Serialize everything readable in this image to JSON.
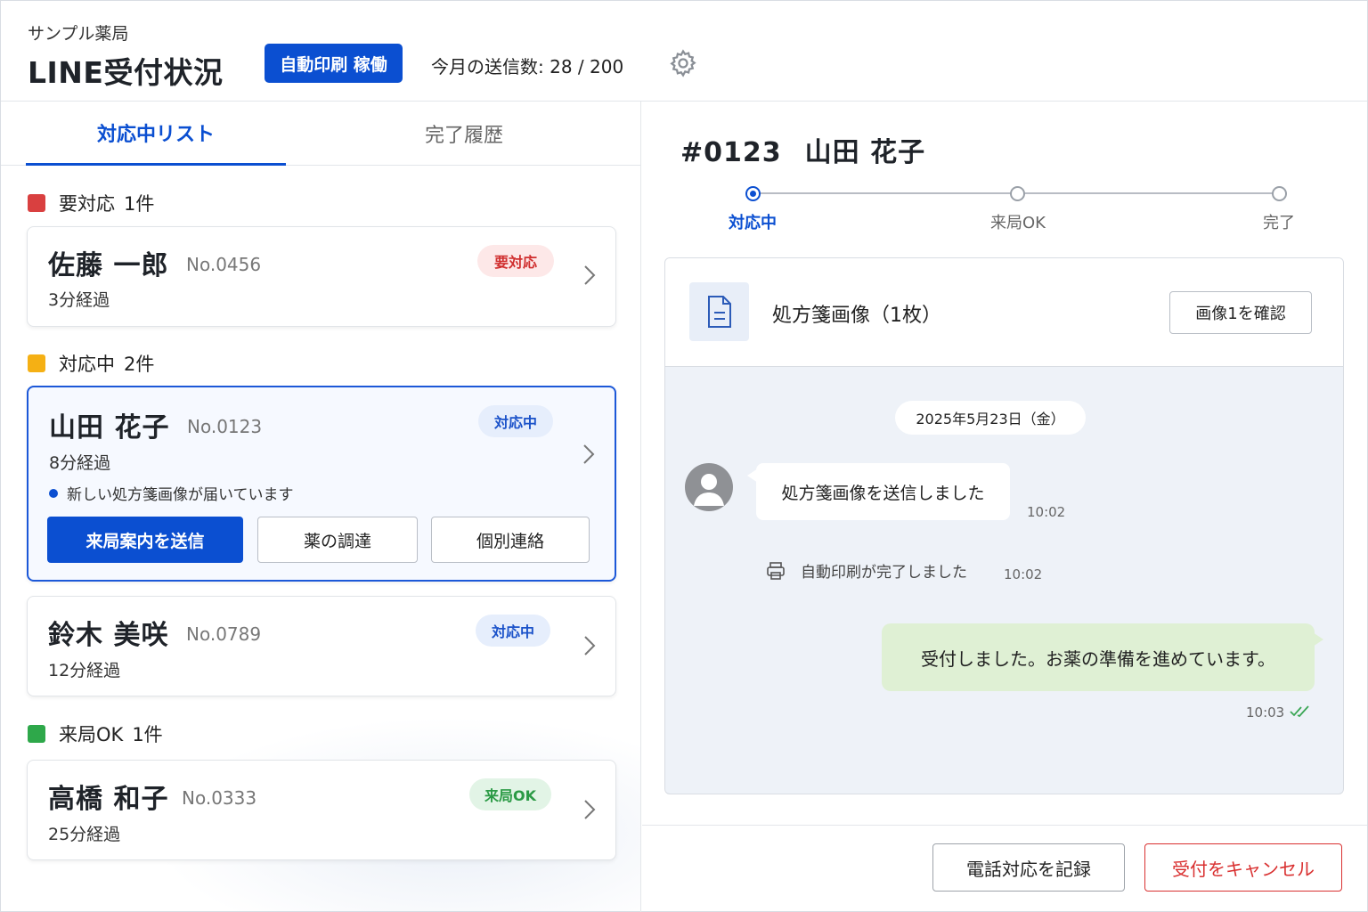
{
  "header": {
    "pharmacy_name": "サンプル薬局",
    "title": "LINE受付状況",
    "autoprint_badge": "自動印刷 稼働",
    "send_count": "今月の送信数: 28 / 200",
    "settings_icon": "gear-icon"
  },
  "tabs": [
    {
      "label": "対応中リスト",
      "active": true
    },
    {
      "label": "完了履歴",
      "active": false
    }
  ],
  "sections": {
    "needs_action": {
      "label": "要対応",
      "count": "1件",
      "color": "#d94040"
    },
    "in_progress": {
      "label": "対応中",
      "count": "2件",
      "color": "#f5b014"
    },
    "arrival_ok": {
      "label": "来局OK",
      "count": "1件",
      "color": "#2ea84a"
    }
  },
  "cards": [
    {
      "name": "佐藤 一郎",
      "no": "No.0456",
      "elapsed": "3分経過",
      "badge": "要対応"
    },
    {
      "name": "山田 花子",
      "no": "No.0123",
      "elapsed": "8分経過",
      "badge": "対応中",
      "notice": "新しい処方箋画像が届いています",
      "actions": [
        "来局案内を送信",
        "薬の調達",
        "個別連絡"
      ]
    },
    {
      "name": "鈴木 美咲",
      "no": "No.0789",
      "elapsed": "12分経過",
      "badge": "対応中"
    },
    {
      "name": "高橋 和子",
      "no": "No.0333",
      "elapsed": "25分経過",
      "badge": "来局OK"
    }
  ],
  "detail": {
    "number": "#0123",
    "name": "山田 花子",
    "steps": [
      {
        "label": "対応中",
        "active": true
      },
      {
        "label": "来局OK",
        "active": false
      },
      {
        "label": "完了",
        "active": false
      }
    ],
    "prescription_title": "処方箋画像（1枚）",
    "view_image_button": "画像1を確認",
    "date": "2025年5月23日（金）",
    "messages": {
      "incoming": {
        "text": "処方箋画像を送信しました",
        "time": "10:02"
      },
      "system": {
        "text": "自動印刷が完了しました",
        "time": "10:02"
      },
      "outgoing": {
        "text": "受付しました。お薬の準備を進めています。",
        "time": "10:03"
      }
    },
    "footer": {
      "phone_button": "電話対応を記録",
      "cancel_button": "受付をキャンセル"
    }
  },
  "colors": {
    "accent": "#0b4fd1",
    "danger": "#d93030",
    "success": "#2ea84a",
    "warning": "#f5b014"
  }
}
